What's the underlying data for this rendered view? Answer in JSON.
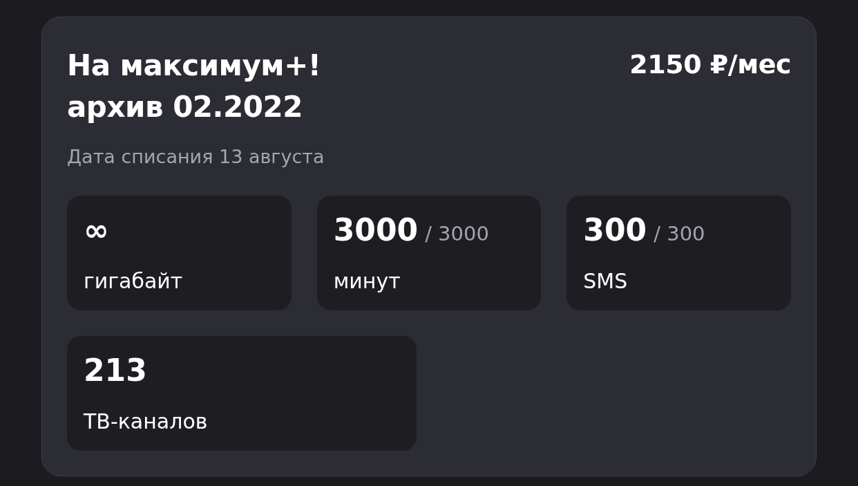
{
  "tariff": {
    "title_lines": [
      "На максимум+!",
      "архив 02.2022"
    ],
    "price": "2150 ₽/мес",
    "charge_date": "Дата списания 13 августа"
  },
  "tile_rows": [
    [
      {
        "value": "∞",
        "label": "гигабайт"
      },
      {
        "value": "3000",
        "total": "/ 3000",
        "label": "минут"
      },
      {
        "value": "300",
        "total": "/ 300",
        "label": "SMS"
      }
    ],
    [
      {
        "value": "213",
        "label": "ТВ-каналов"
      }
    ]
  ]
}
